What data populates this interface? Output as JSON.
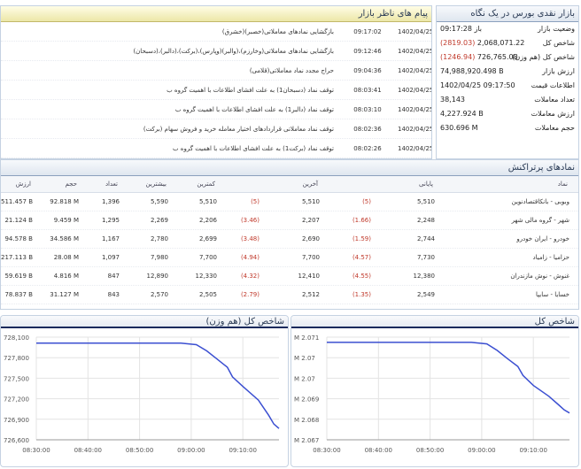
{
  "summary": {
    "title": "بازار نقدی بورس در یک نگاه",
    "rows": [
      {
        "label": "وضعیت بازار",
        "value": "باز 09:17:28",
        "change": ""
      },
      {
        "label": "شاخص کل",
        "value": "2,068,071.22",
        "change": "(2819.03)"
      },
      {
        "label": "شاخص کل (هم وزن)",
        "value": "726,765.08",
        "change": "(1246.94)"
      },
      {
        "label": "ارزش بازار",
        "value": "74,988,920.498 B",
        "change": ""
      },
      {
        "label": "اطلاعات قیمت",
        "value": "1402/04/25 09:17:50",
        "change": ""
      },
      {
        "label": "تعداد معاملات",
        "value": "38,143",
        "change": ""
      },
      {
        "label": "ارزش معاملات",
        "value": "4,227.924 B",
        "change": ""
      },
      {
        "label": "حجم معاملات",
        "value": "630.696 M",
        "change": ""
      }
    ]
  },
  "messages": {
    "title": "پیام های ناظر بازار",
    "rows": [
      {
        "date": "1402/04/25",
        "time": "09:17:02",
        "text": "بازگشایی نمادهای معاملاتی(خصبر)(خشرق)"
      },
      {
        "date": "1402/04/25",
        "time": "09:12:46",
        "text": "بازگشایی نمادهای معاملاتی(وخارزم)،(والبر)(وپارس)،(برکت)،(دالبر)،(دسبحان)"
      },
      {
        "date": "1402/04/25",
        "time": "09:04:36",
        "text": "حراج مجدد نماد معاملاتی(قلامی)"
      },
      {
        "date": "1402/04/25",
        "time": "08:03:41",
        "text": "توقف نماد (دسبحان1) به علت افشای اطلاعات با اهمیت گروه ب"
      },
      {
        "date": "1402/04/25",
        "time": "08:03:10",
        "text": "توقف نماد (دالبر1) به علت افشای اطلاعات با اهمیت گروه ب"
      },
      {
        "date": "1402/04/25",
        "time": "08:02:36",
        "text": "توقف نماد معاملاتی قراردادهای اختیار معامله خرید و فروش سهام (برکت)"
      },
      {
        "date": "1402/04/25",
        "time": "08:02:26",
        "text": "توقف نماد (برکت1) به علت افشای اطلاعات با اهمیت گروه ب"
      }
    ]
  },
  "symbols": {
    "title": "نمادهای پرتراکنش",
    "headers": {
      "name": "نماد",
      "close": "پایانی",
      "last": "آخرین",
      "min": "کمترین",
      "max": "بیشترین",
      "count": "تعداد",
      "volume": "حجم",
      "value": "ارزش"
    },
    "rows": [
      {
        "name": "وبوبی - بانکاقتصادنوین",
        "close": "5,510",
        "close_change": "(5)",
        "last": "5,510",
        "last_change": "(5)",
        "min": "5,510",
        "max": "5,590",
        "count": "1,396",
        "volume": "92.818 M",
        "value": "511.457 B"
      },
      {
        "name": "شهر - گروه مالی شهر",
        "close": "2,248",
        "close_change": "(1.66)",
        "last": "2,207",
        "last_change": "(3.46)",
        "min": "2,206",
        "max": "2,269",
        "count": "1,295",
        "volume": "9.459 M",
        "value": "21.124 B"
      },
      {
        "name": "خودرو - ایران خودرو",
        "close": "2,744",
        "close_change": "(1.59)",
        "last": "2,690",
        "last_change": "(3.48)",
        "min": "2,699",
        "max": "2,780",
        "count": "1,167",
        "volume": "34.586 M",
        "value": "94.578 B"
      },
      {
        "name": "حزامیا - زامیاد",
        "close": "7,730",
        "close_change": "(4.57)",
        "last": "7,700",
        "last_change": "(4.94)",
        "min": "7,700",
        "max": "7,980",
        "count": "1,097",
        "volume": "28.08 M",
        "value": "217.113 B"
      },
      {
        "name": "غنوش - نوش مازندران",
        "close": "12,380",
        "close_change": "(4.55)",
        "last": "12,410",
        "last_change": "(4.32)",
        "min": "12,330",
        "max": "12,890",
        "count": "847",
        "volume": "4.816 M",
        "value": "59.619 B"
      },
      {
        "name": "خسایا - سایپا",
        "close": "2,549",
        "close_change": "(1.35)",
        "last": "2,512",
        "last_change": "(2.79)",
        "min": "2,505",
        "max": "2,570",
        "count": "843",
        "volume": "31.127 M",
        "value": "78.837 B"
      }
    ]
  },
  "colors": {
    "negative": "#c0392b",
    "line": "#3b4fd1",
    "grid": "#e3e3e3"
  },
  "chart_data": [
    {
      "type": "line",
      "title": "شاخص کل (هم وزن)",
      "x_ticks": [
        "08:30:00",
        "08:40:00",
        "08:50:00",
        "09:00:00",
        "09:10:00"
      ],
      "y_ticks": [
        "728,100",
        "727,800",
        "727,500",
        "727,200",
        "726,900",
        "726,600"
      ],
      "ylim": [
        726600,
        728100
      ],
      "x_minutes": [
        0,
        10,
        20,
        28,
        31,
        33,
        35,
        37,
        38,
        40,
        43,
        45,
        46,
        47
      ],
      "values": [
        728012,
        728012,
        728012,
        728012,
        727990,
        727900,
        727780,
        727660,
        727520,
        727380,
        727180,
        726960,
        726830,
        726765
      ],
      "grid": true
    },
    {
      "type": "line",
      "title": "شاخص کل",
      "x_ticks": [
        "08:30:00",
        "08:40:00",
        "08:50:00",
        "09:00:00",
        "09:10:00"
      ],
      "y_ticks": [
        "M 2.071",
        "M 2.07",
        "M 2.07",
        "M 2.069",
        "M 2.068",
        "M 2.067"
      ],
      "ylim": [
        2067000,
        2071100
      ],
      "x_minutes": [
        0,
        10,
        20,
        28,
        31,
        33,
        35,
        37,
        38,
        40,
        43,
        45,
        46,
        47
      ],
      "values": [
        2070890,
        2070890,
        2070890,
        2070890,
        2070830,
        2070570,
        2070240,
        2069930,
        2069570,
        2069170,
        2068740,
        2068380,
        2068190,
        2068071
      ],
      "grid": true
    }
  ]
}
